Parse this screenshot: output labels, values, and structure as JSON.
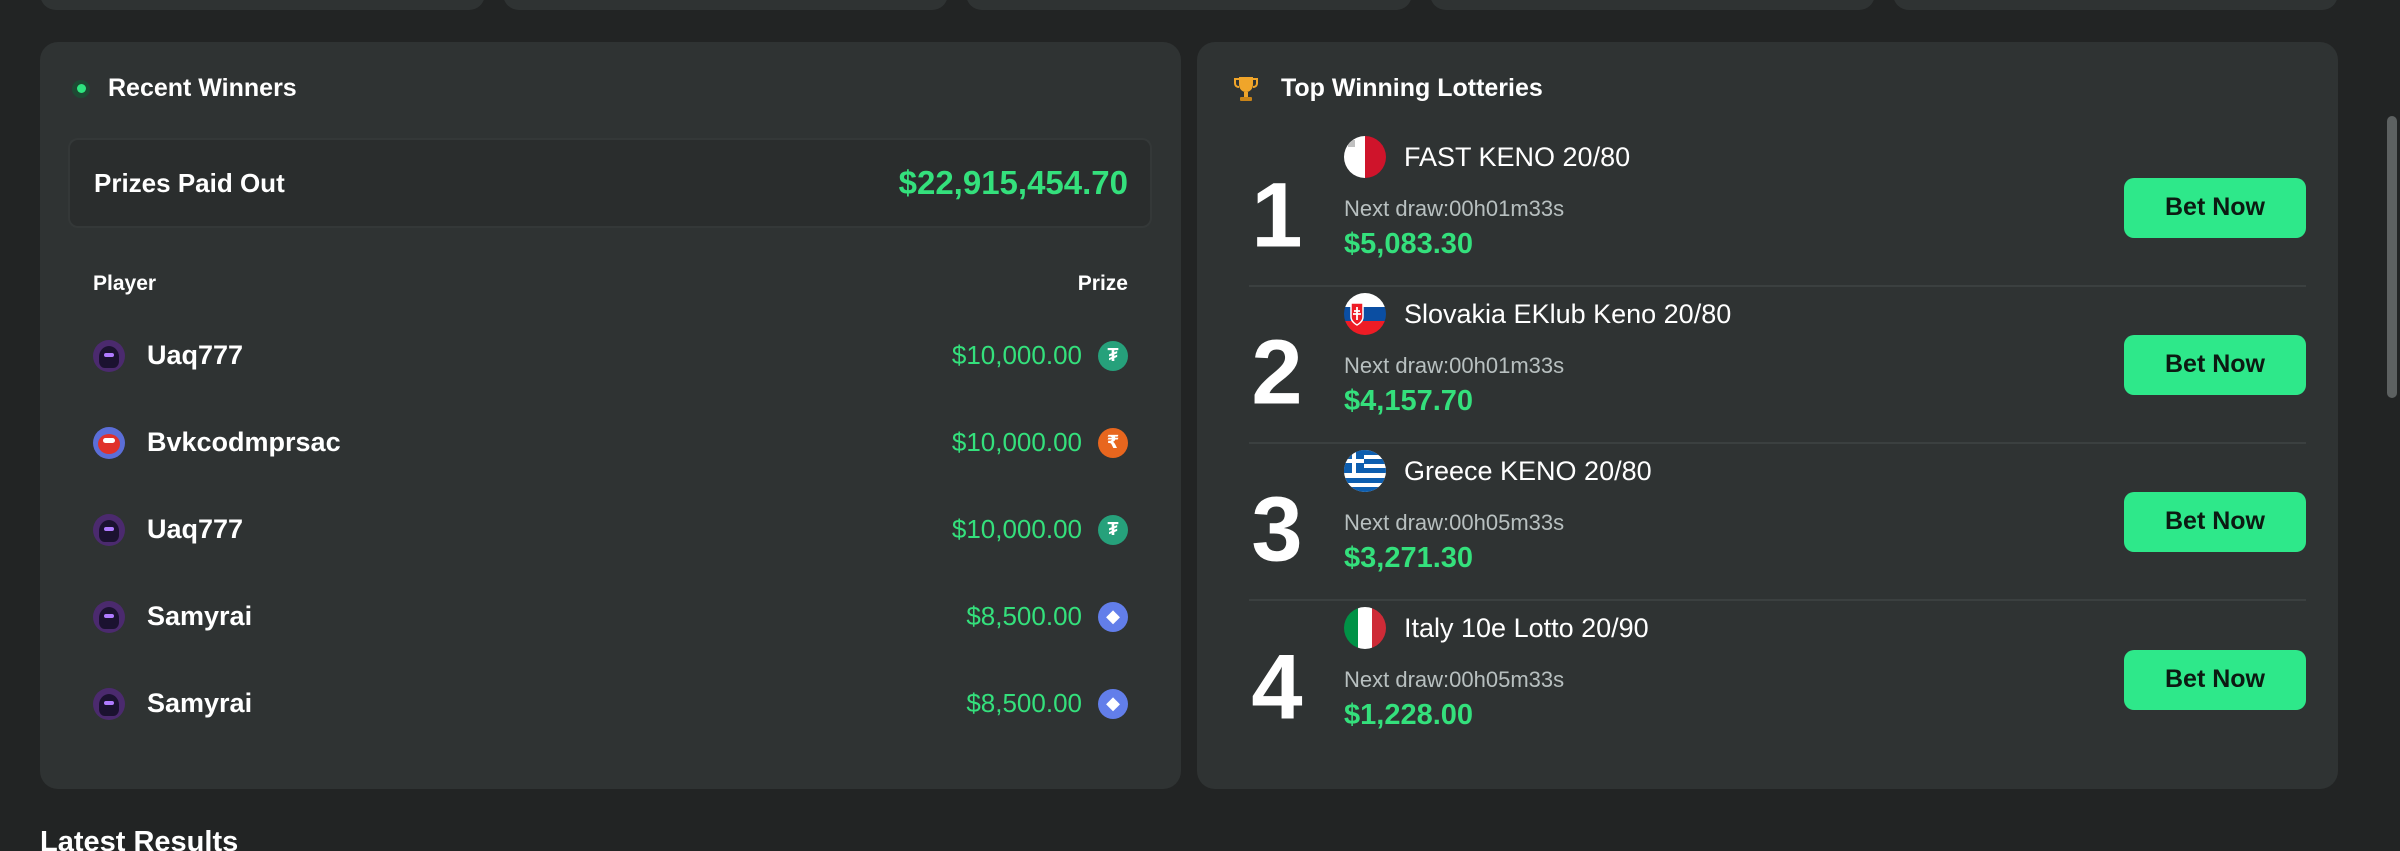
{
  "recent_winners": {
    "title": "Recent Winners",
    "prizes_paid_label": "Prizes Paid Out",
    "prizes_paid_value": "$22,915,454.70",
    "col_player": "Player",
    "col_prize": "Prize",
    "rows": [
      {
        "player": "Uaq777",
        "prize": "$10,000.00",
        "coin": "tether-icon",
        "coin_symbol": "₮",
        "coin_color": "#26a17b"
      },
      {
        "player": "Bvkcodmprsac",
        "prize": "$10,000.00",
        "coin": "rupee-icon",
        "coin_symbol": "₹",
        "coin_color": "#e8661e"
      },
      {
        "player": "Uaq777",
        "prize": "$10,000.00",
        "coin": "tether-icon",
        "coin_symbol": "₮",
        "coin_color": "#26a17b"
      },
      {
        "player": "Samyrai",
        "prize": "$8,500.00",
        "coin": "ethereum-icon",
        "coin_symbol": "◆",
        "coin_color": "#627eea"
      },
      {
        "player": "Samyrai",
        "prize": "$8,500.00",
        "coin": "ethereum-icon",
        "coin_symbol": "◆",
        "coin_color": "#627eea"
      }
    ]
  },
  "top_lotteries": {
    "title": "Top Winning Lotteries",
    "bet_label": "Bet Now",
    "items": [
      {
        "rank": "1",
        "name": "FAST KENO 20/80",
        "next_draw": "Next draw:00h01m33s",
        "jackpot": "$5,083.30",
        "flag": "malta-flag-icon"
      },
      {
        "rank": "2",
        "name": "Slovakia EKlub Keno 20/80",
        "next_draw": "Next draw:00h01m33s",
        "jackpot": "$4,157.70",
        "flag": "slovakia-flag-icon"
      },
      {
        "rank": "3",
        "name": "Greece KENO 20/80",
        "next_draw": "Next draw:00h05m33s",
        "jackpot": "$3,271.30",
        "flag": "greece-flag-icon"
      },
      {
        "rank": "4",
        "name": "Italy 10e Lotto 20/90",
        "next_draw": "Next draw:00h05m33s",
        "jackpot": "$1,228.00",
        "flag": "italy-flag-icon"
      }
    ]
  },
  "latest_results": {
    "title": "Latest Results"
  },
  "colors": {
    "background": "#222424",
    "panel": "#2f3333",
    "accent_green": "#34e07c",
    "button_green": "#2ee88a"
  }
}
